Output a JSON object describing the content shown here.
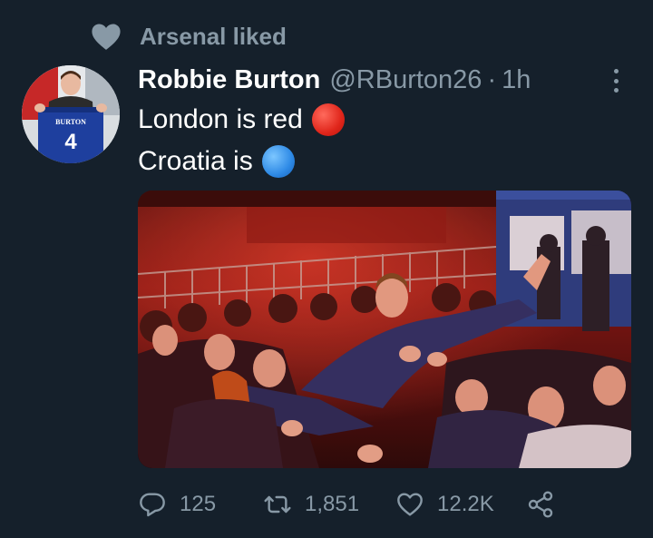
{
  "social_context": {
    "icon": "heart-icon",
    "label": "Arsenal liked"
  },
  "tweet": {
    "author_name": "Robbie Burton",
    "author_handle": "@RBurton26",
    "separator": "·",
    "time": "1h",
    "lines": [
      {
        "text": "London is red",
        "emoji": "red-circle",
        "emoji_color": "#e0261b"
      },
      {
        "text": "Croatia is",
        "emoji": "blue-circle",
        "emoji_color": "#2e8ae6"
      }
    ],
    "avatar": {
      "jersey_name": "BURTON",
      "jersey_number": "4"
    }
  },
  "actions": {
    "reply": {
      "icon": "reply-icon",
      "count": "125"
    },
    "retweet": {
      "icon": "retweet-icon",
      "count": "1,851"
    },
    "like": {
      "icon": "heart-outline-icon",
      "count": "12.2K"
    },
    "share": {
      "icon": "share-icon"
    }
  },
  "colors": {
    "background": "#15202b",
    "secondary_text": "#8899a6",
    "primary_text": "#ffffff"
  }
}
